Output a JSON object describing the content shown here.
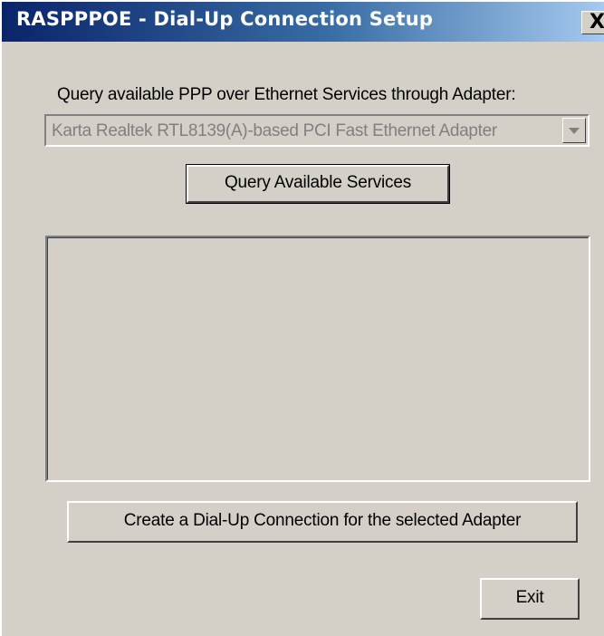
{
  "window": {
    "title": "RASPPPOE - Dial-Up Connection Setup",
    "close_glyph": "X"
  },
  "query": {
    "label": "Query available PPP over Ethernet Services through Adapter:",
    "adapter_selected": "Karta Realtek RTL8139(A)-based PCI Fast Ethernet Adapter",
    "adapter_enabled": false,
    "query_button_label": "Query Available Services"
  },
  "services": {
    "items": []
  },
  "actions": {
    "create_button_label": "Create a Dial-Up Connection for the selected Adapter",
    "exit_button_label": "Exit"
  },
  "colors": {
    "dialog_face": "#d4d0c8",
    "title_gradient_start": "#0a246a",
    "title_gradient_end": "#a6caf0",
    "disabled_text": "#808080"
  },
  "icons": {
    "close": "close-icon",
    "dropdown": "chevron-down-icon"
  }
}
